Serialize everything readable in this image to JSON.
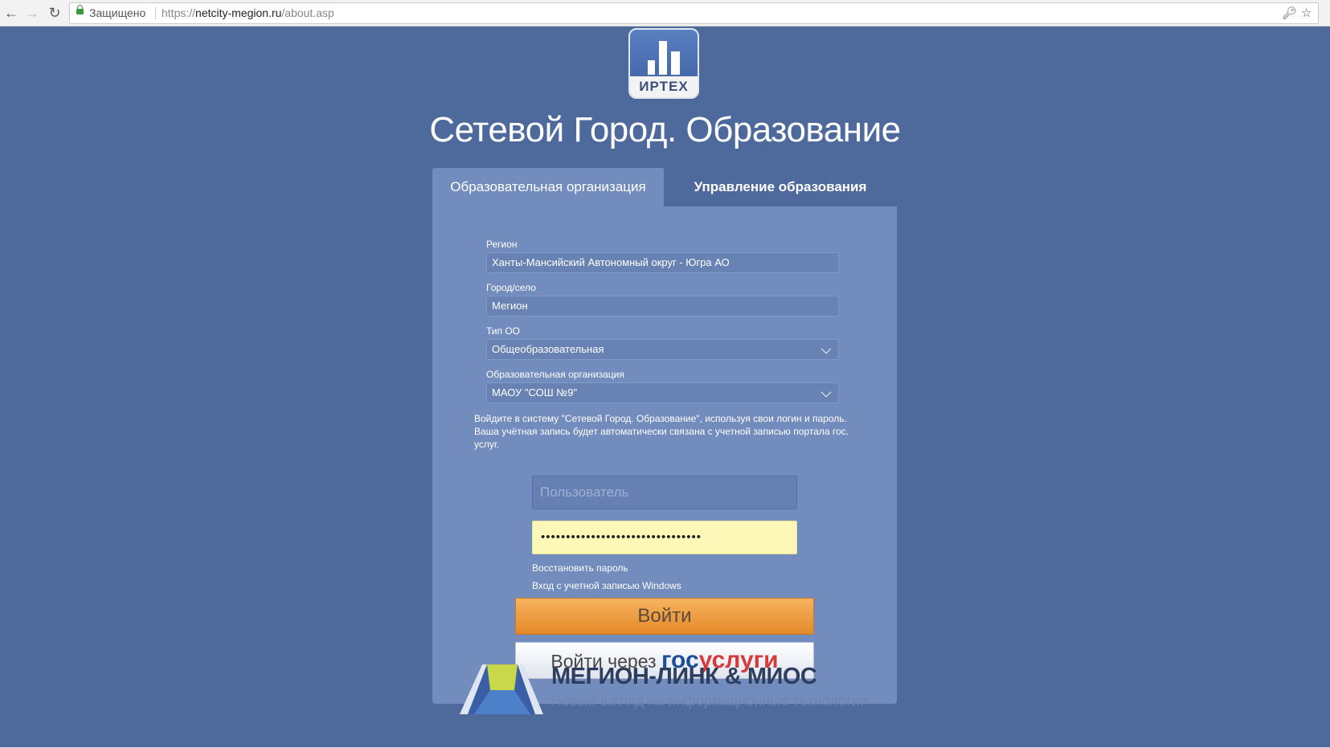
{
  "browser": {
    "security_label": "Защищено",
    "url_scheme": "https://",
    "url_host": "netcity-megion.ru",
    "url_path": "/about.asp"
  },
  "logo": {
    "text": "ИРТЕХ"
  },
  "title": "Сетевой Город. Образование",
  "tabs": [
    {
      "label": "Образовательная организация",
      "active": true
    },
    {
      "label": "Управление образования",
      "active": false
    }
  ],
  "form": {
    "region_label": "Регион",
    "region_value": "Ханты-Мансийский Автономный округ - Югра АО",
    "city_label": "Город/село",
    "city_value": "Мегион",
    "type_label": "Тип ОО",
    "type_value": "Общеобразовательная",
    "org_label": "Образовательная организация",
    "org_value": "МАОУ \"СОШ №9\"",
    "info": "Войдите в систему \"Сетевой Город. Образование\", используя свои логин и пароль. Ваша учётная запись будет автоматически связана с учетной записью портала гос. услуг.",
    "user_placeholder": "Пользователь",
    "password_mask": "••••••••••••••••••••••••••••••••",
    "restore_link": "Восстановить пароль",
    "windows_link": "Вход с учетной записью Windows",
    "login_button": "Войти",
    "gos_button_prefix": "Войти через",
    "gos_part1": "гос",
    "gos_part2": "услуги"
  },
  "footer": {
    "title": "МЕГИОН-ЛИНК & МИОС",
    "subtitle": "Новый взгляд на информационные технологии"
  },
  "colors": {
    "page_bg": "#4e6a9c",
    "panel_bg": "#728cbd",
    "login_button": "#e4892a",
    "password_bg": "#fdf8b8"
  }
}
